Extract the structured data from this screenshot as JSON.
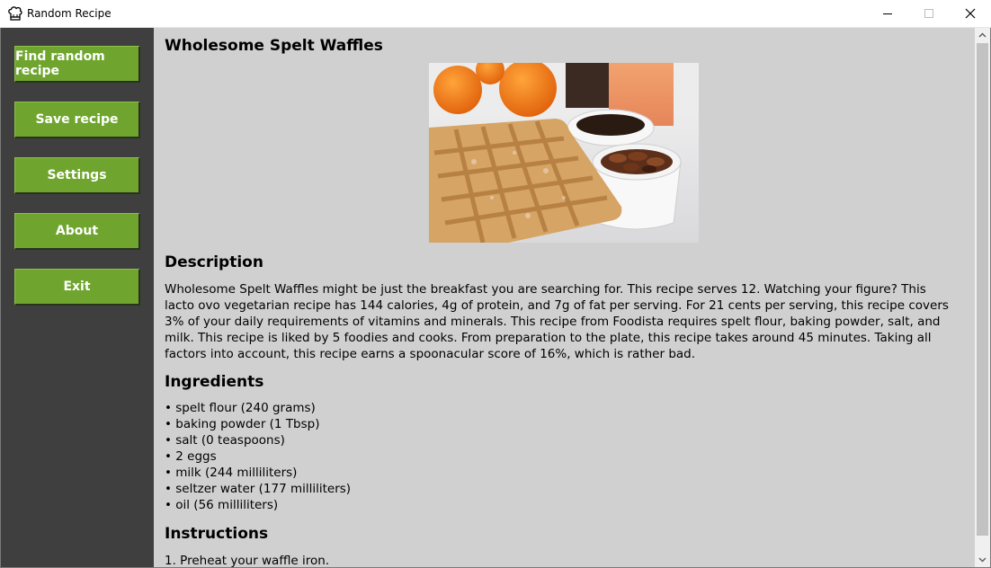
{
  "window": {
    "title": "Random Recipe",
    "icon": "chef-hat-icon"
  },
  "sidebar": {
    "buttons": [
      {
        "label": "Find random recipe"
      },
      {
        "label": "Save recipe"
      },
      {
        "label": "Settings"
      },
      {
        "label": "About"
      },
      {
        "label": "Exit"
      }
    ]
  },
  "recipe": {
    "title": "Wholesome Spelt Waffles",
    "image_alt": "waffles with syrup and pecans",
    "description_heading": "Description",
    "description": "Wholesome Spelt Waffles might be just the breakfast you are searching for. This recipe serves 12. Watching your figure? This lacto ovo vegetarian recipe has 144 calories, 4g of protein, and 7g of fat per serving. For 21 cents per serving, this recipe covers 3% of your daily requirements of vitamins and minerals. This recipe from Foodista requires spelt flour, baking powder, salt, and milk. This recipe is liked by 5 foodies and cooks. From preparation to the plate, this recipe takes around 45 minutes. Taking all factors into account, this recipe earns a spoonacular score of 16%, which is rather bad.",
    "ingredients_heading": "Ingredients",
    "ingredients": [
      "• spelt flour (240 grams)",
      "• baking powder (1 Tbsp)",
      "• salt (0 teaspoons)",
      "• 2 eggs",
      "• milk (244 milliliters)",
      "• seltzer water (177 milliliters)",
      "• oil (56 milliliters)"
    ],
    "instructions_heading": "Instructions",
    "instructions": [
      "1. Preheat your waffle iron."
    ]
  },
  "colors": {
    "sidebar_bg": "#3f3f3f",
    "button_green": "#6fa52e",
    "content_bg": "#d0d0d0"
  }
}
